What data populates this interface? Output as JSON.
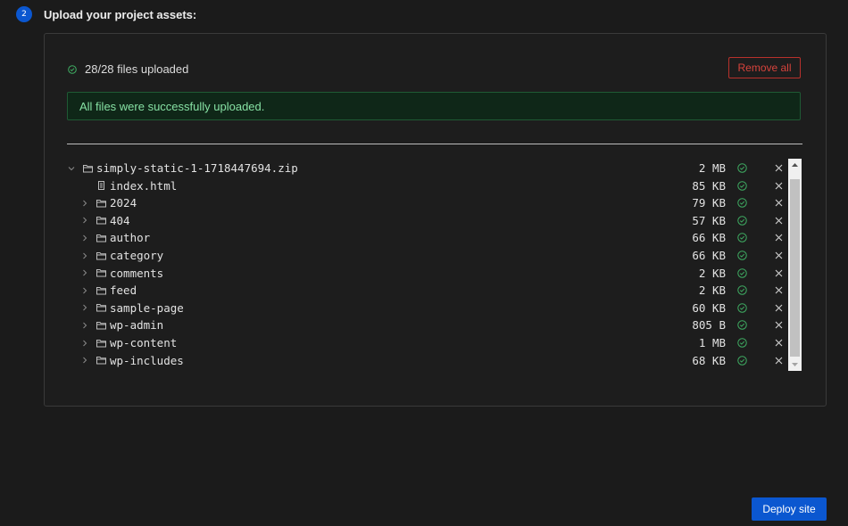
{
  "step": {
    "number": "2",
    "title": "Upload your project assets:"
  },
  "upload": {
    "status_text": "28/28 files uploaded",
    "remove_all_label": "Remove all",
    "success_message": "All files were successfully uploaded."
  },
  "files": [
    {
      "name": "simply-static-1-1718447694.zip",
      "size": "2 MB",
      "type": "zip",
      "expanded": true,
      "level": 0
    },
    {
      "name": "index.html",
      "size": "85 KB",
      "type": "file",
      "level": 1
    },
    {
      "name": "2024",
      "size": "79 KB",
      "type": "folder",
      "level": 1
    },
    {
      "name": "404",
      "size": "57 KB",
      "type": "folder",
      "level": 1
    },
    {
      "name": "author",
      "size": "66 KB",
      "type": "folder",
      "level": 1
    },
    {
      "name": "category",
      "size": "66 KB",
      "type": "folder",
      "level": 1
    },
    {
      "name": "comments",
      "size": "2 KB",
      "type": "folder",
      "level": 1
    },
    {
      "name": "feed",
      "size": "2 KB",
      "type": "folder",
      "level": 1
    },
    {
      "name": "sample-page",
      "size": "60 KB",
      "type": "folder",
      "level": 1
    },
    {
      "name": "wp-admin",
      "size": "805 B",
      "type": "folder",
      "level": 1
    },
    {
      "name": "wp-content",
      "size": "1 MB",
      "type": "folder",
      "level": 1
    },
    {
      "name": "wp-includes",
      "size": "68 KB",
      "type": "folder",
      "level": 1
    }
  ],
  "deploy_label": "Deploy site",
  "colors": {
    "accent": "#0b57d0",
    "success": "#3fae63",
    "danger": "#d6433c"
  },
  "icons": {
    "status": "check-circle-icon",
    "expand": "chevron-icon",
    "folder": "folder-icon",
    "file": "file-icon",
    "remove": "close-icon"
  }
}
